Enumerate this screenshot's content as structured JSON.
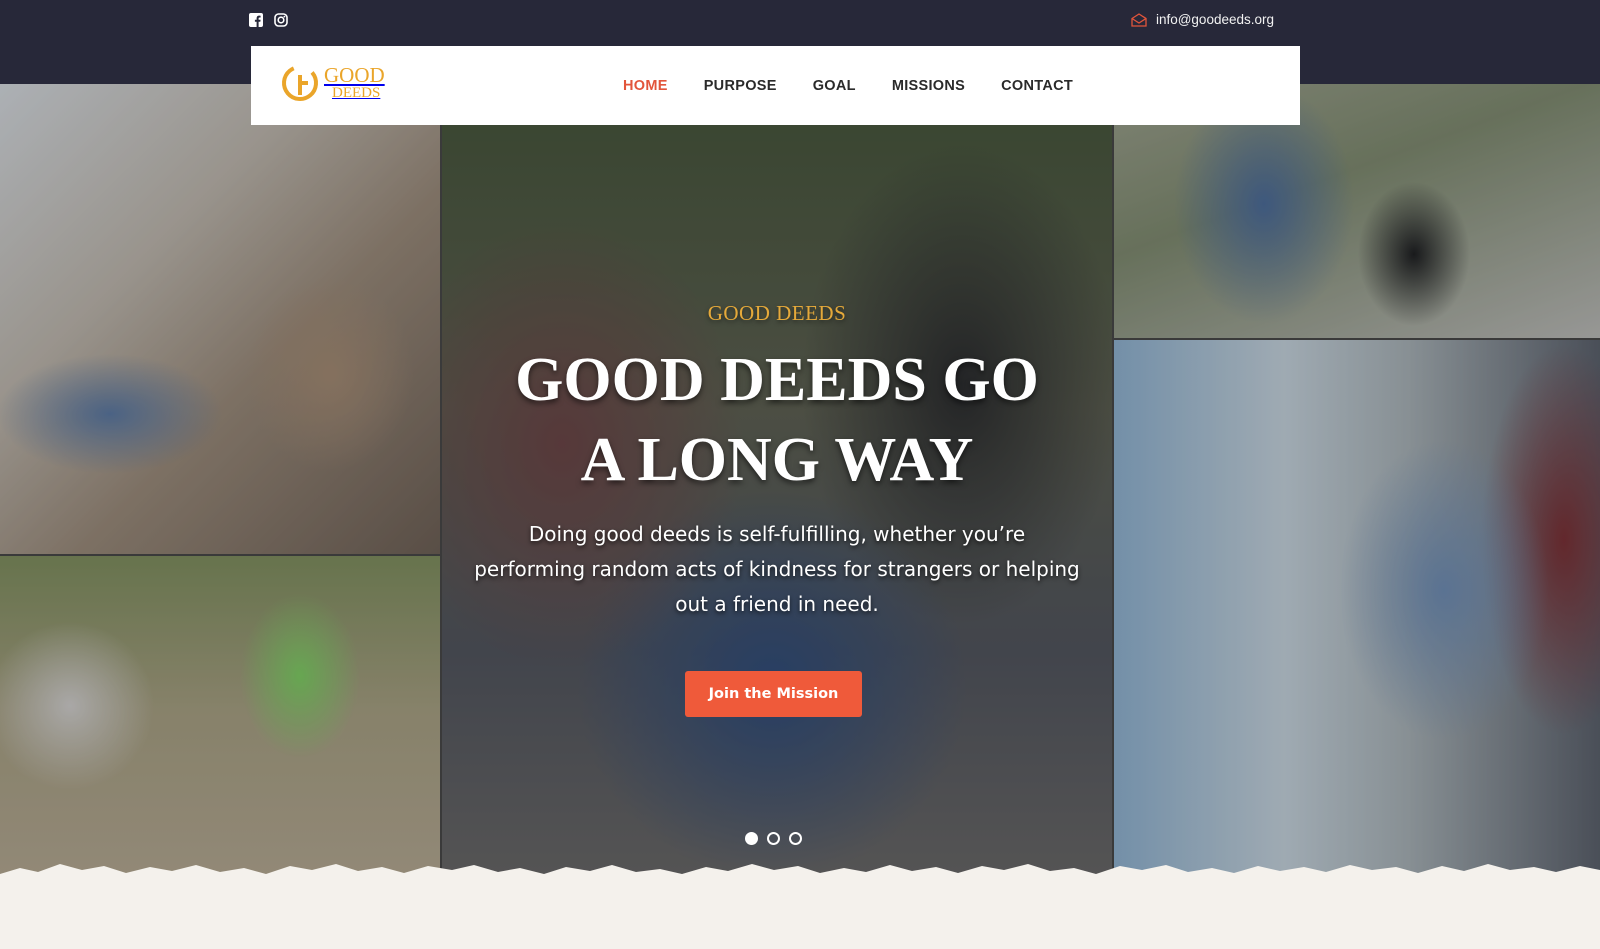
{
  "topbar": {
    "social": [
      "facebook-icon",
      "instagram-icon"
    ],
    "email": "info@goodeeds.org"
  },
  "brand": {
    "line1": "GOOD",
    "line2": "DEEDS",
    "color": "#eaa52a"
  },
  "nav": {
    "items": [
      {
        "label": "HOME",
        "active": true
      },
      {
        "label": "PURPOSE",
        "active": false
      },
      {
        "label": "GOAL",
        "active": false
      },
      {
        "label": "MISSIONS",
        "active": false
      },
      {
        "label": "CONTACT",
        "active": false
      }
    ],
    "active_color": "#e2553b"
  },
  "hero": {
    "eyebrow": "GOOD DEEDS",
    "headline_line1": "GOOD DEEDS GO",
    "headline_line2": "A LONG WAY",
    "subtext_line1": "Doing good deeds is self-fulfilling, whether you’re",
    "subtext_line2": "performing random acts of kindness for strangers or helping",
    "subtext_line3": "out a friend in need.",
    "cta_label": "Join the Mission",
    "cta_color": "#ef5a3a",
    "slides": 3,
    "active_slide": 1
  },
  "colors": {
    "topbar_bg": "#272839",
    "eyebrow": "#e5a93a",
    "paper": "#f4f1ec"
  }
}
